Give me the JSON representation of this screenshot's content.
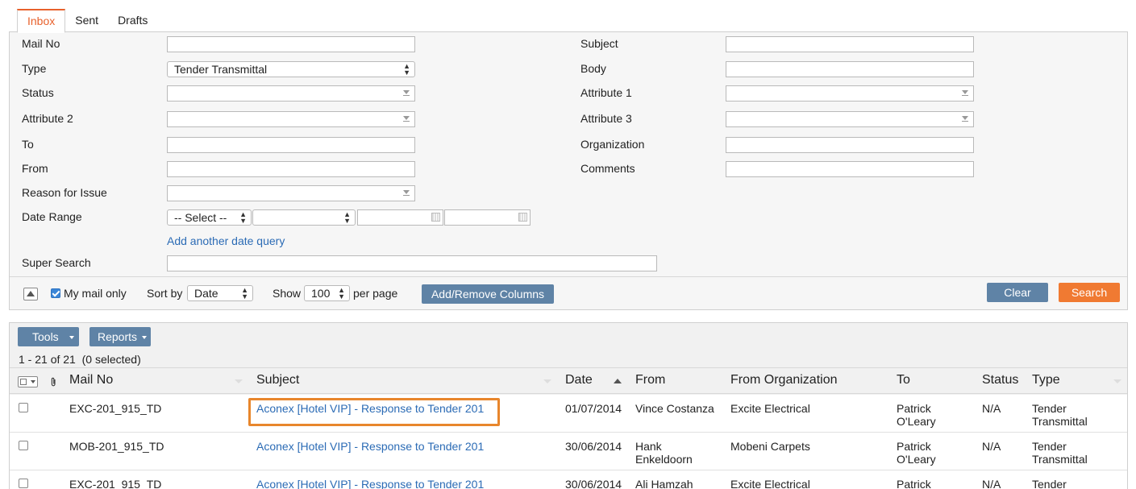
{
  "tabs": [
    "Inbox",
    "Sent",
    "Drafts"
  ],
  "form": {
    "mail_no": "Mail No",
    "type": "Type",
    "type_value": "Tender Transmittal",
    "status": "Status",
    "attribute2": "Attribute 2",
    "to": "To",
    "from": "From",
    "reason": "Reason for Issue",
    "date_range": "Date Range",
    "date_select": "-- Select --",
    "add_date_query": "Add another date query",
    "super_search": "Super Search",
    "subject": "Subject",
    "body": "Body",
    "attribute1": "Attribute 1",
    "attribute3": "Attribute 3",
    "organization": "Organization",
    "comments": "Comments"
  },
  "footer": {
    "my_mail_only": "My mail only",
    "sort_by": "Sort by",
    "sort_value": "Date",
    "show": "Show",
    "per_page_value": "100",
    "per_page": "per page",
    "add_remove_columns": "Add/Remove Columns",
    "clear": "Clear",
    "search": "Search"
  },
  "results": {
    "tools": "Tools",
    "reports": "Reports",
    "count": "1 - 21 of 21",
    "selected": "(0 selected)",
    "columns": [
      "Mail No",
      "Subject",
      "Date",
      "From",
      "From Organization",
      "To",
      "Status",
      "Type"
    ],
    "rows": [
      {
        "mail_no": "EXC-201_915_TD",
        "subject": "Aconex [Hotel VIP] - Response to Tender 201",
        "date": "01/07/2014",
        "from": "Vince Costanza",
        "org": "Excite Electrical",
        "to": "Patrick O'Leary",
        "status": "N/A",
        "type": "Tender Transmittal"
      },
      {
        "mail_no": "MOB-201_915_TD",
        "subject": "Aconex [Hotel VIP] - Response to Tender 201",
        "date": "30/06/2014",
        "from": "Hank Enkeldoorn",
        "org": "Mobeni Carpets",
        "to": "Patrick O'Leary",
        "status": "N/A",
        "type": "Tender Transmittal"
      },
      {
        "mail_no": "EXC-201_915_TD",
        "subject": "Aconex [Hotel VIP] - Response to Tender 201",
        "date": "30/06/2014",
        "from": "Ali Hamzah",
        "org": "Excite Electrical",
        "to": "Patrick O'Leary",
        "status": "N/A",
        "type": "Tender Transmittal"
      }
    ]
  },
  "colors": {
    "accent": "#e8612c",
    "button": "#5f83a6",
    "link": "#2b6bb5"
  }
}
